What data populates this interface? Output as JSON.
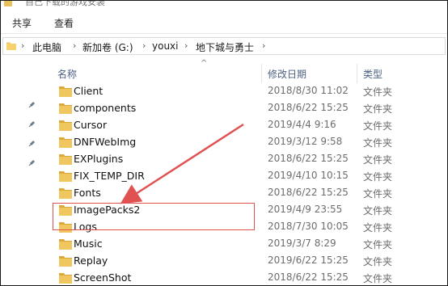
{
  "window": {
    "title_fragment": "自己下载的游戏安装"
  },
  "ribbon": {
    "tabs": [
      {
        "label": "共享"
      },
      {
        "label": "查看"
      }
    ]
  },
  "address": {
    "crumbs": [
      "此电脑",
      "新加卷 (G:)",
      "youxi",
      "地下城与勇士"
    ],
    "separator": "›"
  },
  "columns": {
    "name": "名称",
    "modified": "修改日期",
    "type": "类型"
  },
  "files": [
    {
      "name": "Client",
      "date": "2018/8/30 11:02",
      "type": "文件夹"
    },
    {
      "name": "components",
      "date": "2018/6/22 15:25",
      "type": "文件夹"
    },
    {
      "name": "Cursor",
      "date": "2019/4/4 9:16",
      "type": "文件夹"
    },
    {
      "name": "DNFWebImg",
      "date": "2019/3/12 9:58",
      "type": "文件夹"
    },
    {
      "name": "EXPlugins",
      "date": "2018/6/22 15:25",
      "type": "文件夹"
    },
    {
      "name": "FIX_TEMP_DIR",
      "date": "2019/4/10 10:15",
      "type": "文件夹"
    },
    {
      "name": "Fonts",
      "date": "2018/6/22 15:25",
      "type": "文件夹"
    },
    {
      "name": "ImagePacks2",
      "date": "2019/4/9 23:55",
      "type": "文件夹"
    },
    {
      "name": "Logs",
      "date": "2018/7/30 10:05",
      "type": "文件夹"
    },
    {
      "name": "Music",
      "date": "2019/3/7 8:29",
      "type": "文件夹"
    },
    {
      "name": "Replay",
      "date": "2019/6/22 15:25",
      "type": "文件夹"
    },
    {
      "name": "ScreenShot",
      "date": "2018/6/22 15:25",
      "type": "文件夹"
    }
  ],
  "annotation": {
    "highlighted_item": "ImagePacks2",
    "color": "#e05252"
  },
  "colors": {
    "folder": "#f0c75e",
    "folder_dark": "#dba93a",
    "header_text": "#4d6082"
  }
}
